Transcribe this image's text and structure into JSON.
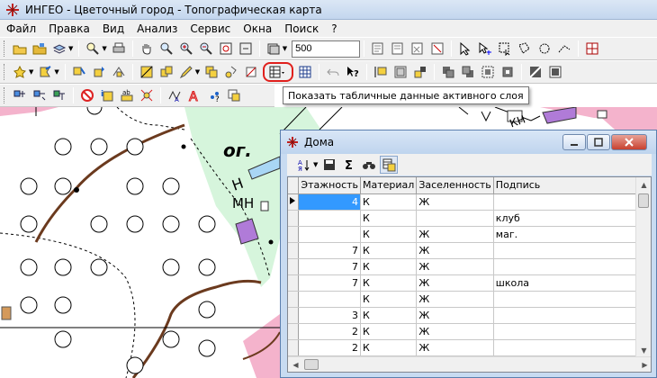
{
  "window": {
    "title": "ИНГЕО - Цветочный город - Топографическая карта"
  },
  "menu": [
    "Файл",
    "Правка",
    "Вид",
    "Анализ",
    "Сервис",
    "Окна",
    "Поиск",
    "?"
  ],
  "toolbar": {
    "zoom_value": "500"
  },
  "tooltip": {
    "text": "Показать табличные данные активного слоя"
  },
  "map": {
    "labels": {
      "area_code": "ог.",
      "letter_n": "Н",
      "label_mn": "МН",
      "label_kn": "КН"
    },
    "colors": {
      "green_zone": "#d6f5dc",
      "pink_zone": "#f4b3cc",
      "building": "#b07bd8",
      "road": "#6b3a1e",
      "blue_strip": "#a9d6f5"
    }
  },
  "table_window": {
    "title": "Дома",
    "columns": [
      "Этажность",
      "Материал",
      "Заселенность",
      "Подпись"
    ],
    "rows": [
      [
        "4",
        "К",
        "Ж",
        ""
      ],
      [
        "",
        "К",
        "",
        "клуб"
      ],
      [
        "",
        "К",
        "Ж",
        "маг."
      ],
      [
        "7",
        "К",
        "Ж",
        ""
      ],
      [
        "7",
        "К",
        "Ж",
        ""
      ],
      [
        "7",
        "К",
        "Ж",
        "школа"
      ],
      [
        "",
        "К",
        "Ж",
        ""
      ],
      [
        "3",
        "К",
        "Ж",
        ""
      ],
      [
        "2",
        "К",
        "Ж",
        ""
      ],
      [
        "2",
        "К",
        "Ж",
        ""
      ]
    ]
  }
}
